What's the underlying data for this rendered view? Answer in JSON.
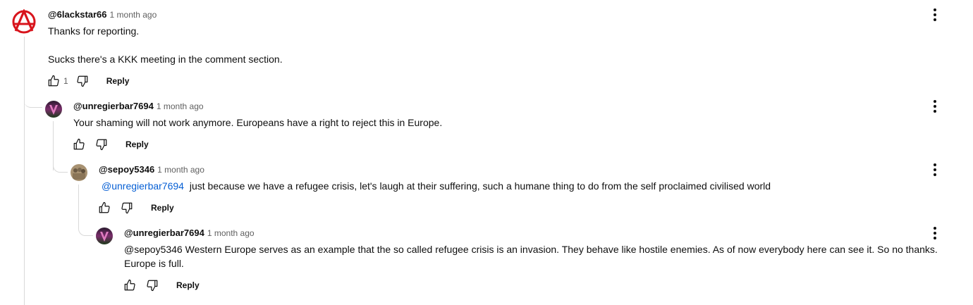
{
  "comments": [
    {
      "handle": "@6lackstar66",
      "time": "1 month ago",
      "lines": [
        "Thanks for reporting.",
        "Sucks there's a KKK meeting in the comment section."
      ],
      "likes": "1",
      "reply_label": "Reply",
      "avatar_icon": "anarchy-symbol-icon"
    },
    {
      "handle": "@unregierbar7694",
      "time": "1 month ago",
      "text": "Your shaming will not work anymore. Europeans have a right to reject this in Europe.",
      "reply_label": "Reply",
      "avatar_icon": "gradient-avatar"
    },
    {
      "handle": "@sepoy5346",
      "time": "1 month ago",
      "mention": "@unregierbar7694",
      "text": "just because we have a refugee crisis, let's laugh at their suffering, such a humane thing to do from the self proclaimed civilised world",
      "reply_label": "Reply",
      "avatar_icon": "photo-avatar"
    },
    {
      "handle": "@unregierbar7694",
      "time": "1 month ago",
      "lines": [
        "@sepoy5346 Western Europe serves as an example that the so called refugee crisis is an invasion. They behave like hostile enemies. As of now everybody here can see it. So no thanks.",
        "Europe is full."
      ],
      "reply_label": "Reply",
      "avatar_icon": "gradient-avatar"
    }
  ],
  "colors": {
    "mention": "#065fd4",
    "meta": "#606060",
    "text": "#0f0f0f"
  }
}
